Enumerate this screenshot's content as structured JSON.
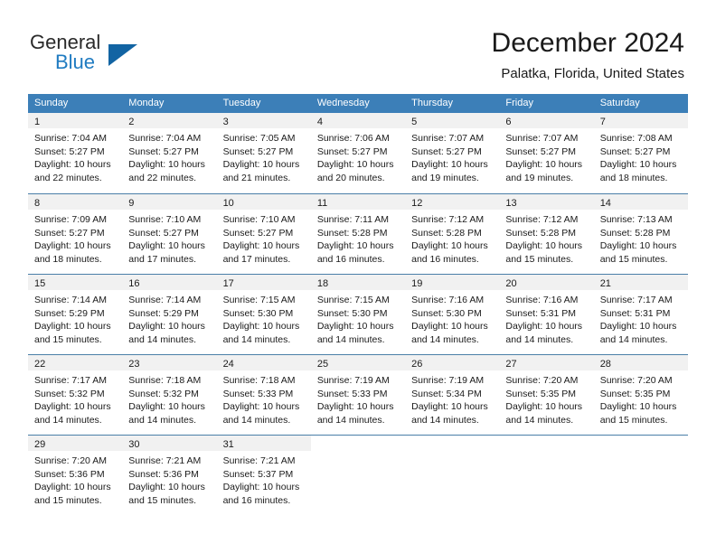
{
  "brand": {
    "name_top": "General",
    "name_bottom": "Blue",
    "accent_color": "#1264a3",
    "blue_text_color": "#1f7bc1"
  },
  "header": {
    "title": "December 2024",
    "subtitle": "Palatka, Florida, United States"
  },
  "calendar": {
    "header_bg": "#3c7fb8",
    "daynum_bg": "#f1f1f1",
    "weekdays": [
      "Sunday",
      "Monday",
      "Tuesday",
      "Wednesday",
      "Thursday",
      "Friday",
      "Saturday"
    ],
    "weeks": [
      [
        {
          "day": "1",
          "lines": [
            "Sunrise: 7:04 AM",
            "Sunset: 5:27 PM",
            "Daylight: 10 hours",
            "and 22 minutes."
          ]
        },
        {
          "day": "2",
          "lines": [
            "Sunrise: 7:04 AM",
            "Sunset: 5:27 PM",
            "Daylight: 10 hours",
            "and 22 minutes."
          ]
        },
        {
          "day": "3",
          "lines": [
            "Sunrise: 7:05 AM",
            "Sunset: 5:27 PM",
            "Daylight: 10 hours",
            "and 21 minutes."
          ]
        },
        {
          "day": "4",
          "lines": [
            "Sunrise: 7:06 AM",
            "Sunset: 5:27 PM",
            "Daylight: 10 hours",
            "and 20 minutes."
          ]
        },
        {
          "day": "5",
          "lines": [
            "Sunrise: 7:07 AM",
            "Sunset: 5:27 PM",
            "Daylight: 10 hours",
            "and 19 minutes."
          ]
        },
        {
          "day": "6",
          "lines": [
            "Sunrise: 7:07 AM",
            "Sunset: 5:27 PM",
            "Daylight: 10 hours",
            "and 19 minutes."
          ]
        },
        {
          "day": "7",
          "lines": [
            "Sunrise: 7:08 AM",
            "Sunset: 5:27 PM",
            "Daylight: 10 hours",
            "and 18 minutes."
          ]
        }
      ],
      [
        {
          "day": "8",
          "lines": [
            "Sunrise: 7:09 AM",
            "Sunset: 5:27 PM",
            "Daylight: 10 hours",
            "and 18 minutes."
          ]
        },
        {
          "day": "9",
          "lines": [
            "Sunrise: 7:10 AM",
            "Sunset: 5:27 PM",
            "Daylight: 10 hours",
            "and 17 minutes."
          ]
        },
        {
          "day": "10",
          "lines": [
            "Sunrise: 7:10 AM",
            "Sunset: 5:27 PM",
            "Daylight: 10 hours",
            "and 17 minutes."
          ]
        },
        {
          "day": "11",
          "lines": [
            "Sunrise: 7:11 AM",
            "Sunset: 5:28 PM",
            "Daylight: 10 hours",
            "and 16 minutes."
          ]
        },
        {
          "day": "12",
          "lines": [
            "Sunrise: 7:12 AM",
            "Sunset: 5:28 PM",
            "Daylight: 10 hours",
            "and 16 minutes."
          ]
        },
        {
          "day": "13",
          "lines": [
            "Sunrise: 7:12 AM",
            "Sunset: 5:28 PM",
            "Daylight: 10 hours",
            "and 15 minutes."
          ]
        },
        {
          "day": "14",
          "lines": [
            "Sunrise: 7:13 AM",
            "Sunset: 5:28 PM",
            "Daylight: 10 hours",
            "and 15 minutes."
          ]
        }
      ],
      [
        {
          "day": "15",
          "lines": [
            "Sunrise: 7:14 AM",
            "Sunset: 5:29 PM",
            "Daylight: 10 hours",
            "and 15 minutes."
          ]
        },
        {
          "day": "16",
          "lines": [
            "Sunrise: 7:14 AM",
            "Sunset: 5:29 PM",
            "Daylight: 10 hours",
            "and 14 minutes."
          ]
        },
        {
          "day": "17",
          "lines": [
            "Sunrise: 7:15 AM",
            "Sunset: 5:30 PM",
            "Daylight: 10 hours",
            "and 14 minutes."
          ]
        },
        {
          "day": "18",
          "lines": [
            "Sunrise: 7:15 AM",
            "Sunset: 5:30 PM",
            "Daylight: 10 hours",
            "and 14 minutes."
          ]
        },
        {
          "day": "19",
          "lines": [
            "Sunrise: 7:16 AM",
            "Sunset: 5:30 PM",
            "Daylight: 10 hours",
            "and 14 minutes."
          ]
        },
        {
          "day": "20",
          "lines": [
            "Sunrise: 7:16 AM",
            "Sunset: 5:31 PM",
            "Daylight: 10 hours",
            "and 14 minutes."
          ]
        },
        {
          "day": "21",
          "lines": [
            "Sunrise: 7:17 AM",
            "Sunset: 5:31 PM",
            "Daylight: 10 hours",
            "and 14 minutes."
          ]
        }
      ],
      [
        {
          "day": "22",
          "lines": [
            "Sunrise: 7:17 AM",
            "Sunset: 5:32 PM",
            "Daylight: 10 hours",
            "and 14 minutes."
          ]
        },
        {
          "day": "23",
          "lines": [
            "Sunrise: 7:18 AM",
            "Sunset: 5:32 PM",
            "Daylight: 10 hours",
            "and 14 minutes."
          ]
        },
        {
          "day": "24",
          "lines": [
            "Sunrise: 7:18 AM",
            "Sunset: 5:33 PM",
            "Daylight: 10 hours",
            "and 14 minutes."
          ]
        },
        {
          "day": "25",
          "lines": [
            "Sunrise: 7:19 AM",
            "Sunset: 5:33 PM",
            "Daylight: 10 hours",
            "and 14 minutes."
          ]
        },
        {
          "day": "26",
          "lines": [
            "Sunrise: 7:19 AM",
            "Sunset: 5:34 PM",
            "Daylight: 10 hours",
            "and 14 minutes."
          ]
        },
        {
          "day": "27",
          "lines": [
            "Sunrise: 7:20 AM",
            "Sunset: 5:35 PM",
            "Daylight: 10 hours",
            "and 14 minutes."
          ]
        },
        {
          "day": "28",
          "lines": [
            "Sunrise: 7:20 AM",
            "Sunset: 5:35 PM",
            "Daylight: 10 hours",
            "and 15 minutes."
          ]
        }
      ],
      [
        {
          "day": "29",
          "lines": [
            "Sunrise: 7:20 AM",
            "Sunset: 5:36 PM",
            "Daylight: 10 hours",
            "and 15 minutes."
          ]
        },
        {
          "day": "30",
          "lines": [
            "Sunrise: 7:21 AM",
            "Sunset: 5:36 PM",
            "Daylight: 10 hours",
            "and 15 minutes."
          ]
        },
        {
          "day": "31",
          "lines": [
            "Sunrise: 7:21 AM",
            "Sunset: 5:37 PM",
            "Daylight: 10 hours",
            "and 16 minutes."
          ]
        },
        {
          "day": "",
          "lines": []
        },
        {
          "day": "",
          "lines": []
        },
        {
          "day": "",
          "lines": []
        },
        {
          "day": "",
          "lines": []
        }
      ]
    ]
  }
}
